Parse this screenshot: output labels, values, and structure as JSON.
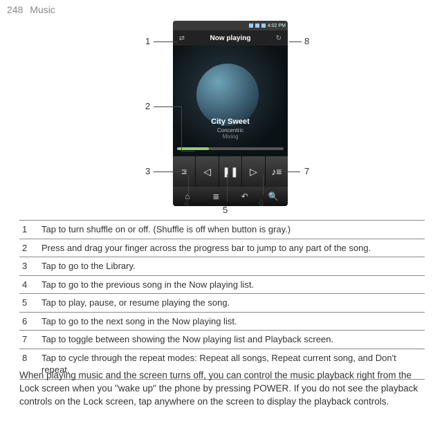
{
  "header": {
    "page_number": "248",
    "section": "Music"
  },
  "phone": {
    "now_playing_label": "Now playing",
    "track_title": "City Sweet",
    "track_artist": "Concentric",
    "track_album": "Mixing",
    "status_time": "4:02 PM"
  },
  "callouts": {
    "c1": "1",
    "c2": "2",
    "c3": "3",
    "c4": "4",
    "c5": "5",
    "c6": "6",
    "c7": "7",
    "c8": "8"
  },
  "rows": [
    {
      "n": "1",
      "t": "Tap to turn shuffle on or off. (Shuffle is off when button is gray.)"
    },
    {
      "n": "2",
      "t": "Press and drag your finger across the progress bar to jump to any part of the song."
    },
    {
      "n": "3",
      "t": "Tap to go to the Library."
    },
    {
      "n": "4",
      "t": "Tap to go to the previous song in the Now playing list."
    },
    {
      "n": "5",
      "t": "Tap to play, pause, or resume playing the song."
    },
    {
      "n": "6",
      "t": "Tap to go to the next song in the Now playing list."
    },
    {
      "n": "7",
      "t": "Tap to toggle between showing the Now playing list and Playback screen."
    },
    {
      "n": "8",
      "t": "Tap to cycle through the repeat modes: Repeat all songs, Repeat current song, and Don't repeat."
    }
  ],
  "paragraph": "When playing music and the screen turns off, you can control the music playback right from the Lock screen when you \"wake up\" the phone by pressing POWER. If you do not see the playback controls on the Lock screen, tap anywhere on the screen to display the playback controls."
}
